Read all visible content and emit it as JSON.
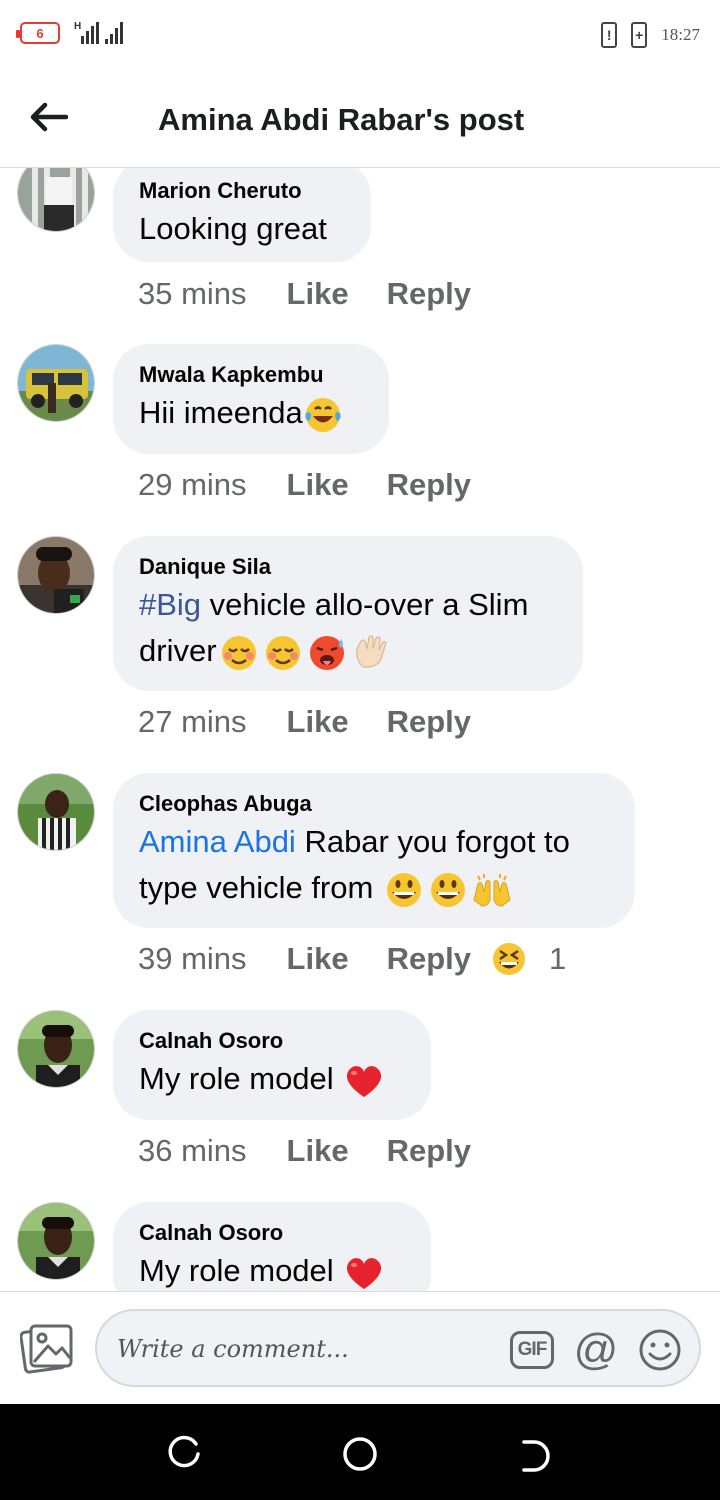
{
  "status_bar": {
    "battery_level": "6",
    "signal_label": "H",
    "time": "18:27",
    "alert_badge": "!",
    "charge_badge": "+"
  },
  "header": {
    "title": "Amina Abdi Rabar's post"
  },
  "comments": [
    {
      "author": "Marion Cheruto",
      "text": "Looking great",
      "time": "35 mins",
      "like_label": "Like",
      "reply_label": "Reply"
    },
    {
      "author": "Mwala Kapkembu",
      "text": "Hii imeenda",
      "emojis": [
        "laughing-tears"
      ],
      "time": "29 mins",
      "like_label": "Like",
      "reply_label": "Reply"
    },
    {
      "author": "Danique Sila",
      "hashtag": "#Big",
      "text_line1": " vehicle allo-over a Slim",
      "text_line2": "driver",
      "emojis": [
        "relieved",
        "relieved",
        "hot-face",
        "waving-hand"
      ],
      "time": "27 mins",
      "like_label": "Like",
      "reply_label": "Reply"
    },
    {
      "author": "Cleophas Abuga",
      "mention": "Amina Abdi",
      "text_line1": " Rabar you forgot to",
      "text_line2": "type vehicle from ",
      "emojis": [
        "grinning",
        "grinning",
        "raising-hands"
      ],
      "time": "39 mins",
      "like_label": "Like",
      "reply_label": "Reply",
      "reaction_emoji": "squinting-laugh",
      "reaction_count": "1"
    },
    {
      "author": "Calnah Osoro",
      "text": "My role model ",
      "emojis": [
        "red-heart"
      ],
      "time": "36 mins",
      "like_label": "Like",
      "reply_label": "Reply"
    },
    {
      "author": "Calnah Osoro",
      "text": "My role model ",
      "emojis": [
        "red-heart"
      ]
    }
  ],
  "composer": {
    "placeholder": "Write a comment...",
    "gif_label": "GIF",
    "mention_symbol": "@"
  },
  "colors": {
    "bubble": "#eff1f4",
    "meta_text": "#65676b",
    "hashtag": "#385898",
    "mention": "#1b74e4",
    "battery_low": "#e53935"
  }
}
